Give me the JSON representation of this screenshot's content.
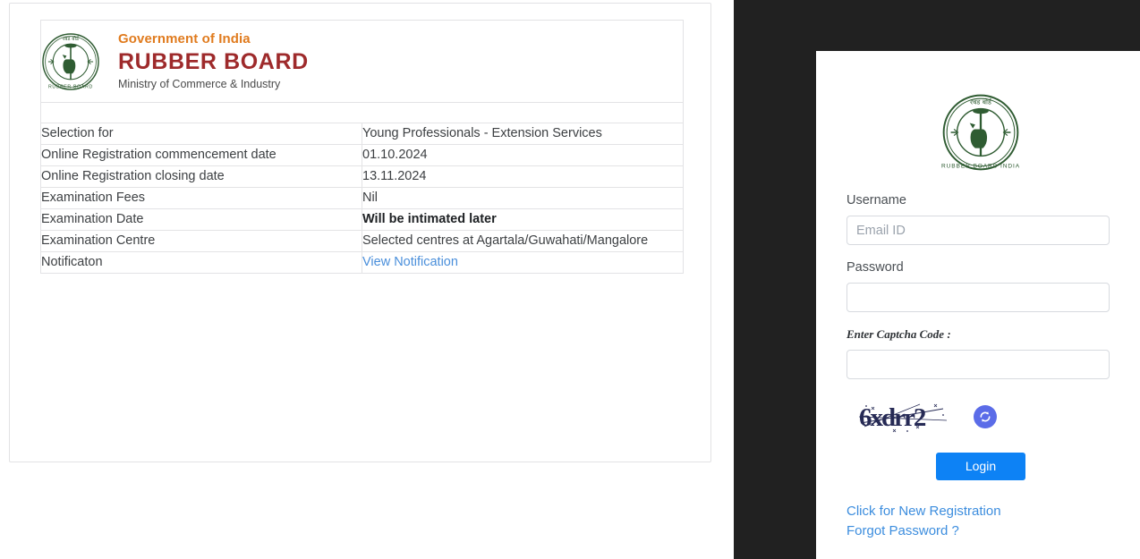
{
  "branding": {
    "emblem_icon": "rubber-board-emblem-icon",
    "gov_line": "Government of India",
    "org_name": "RUBBER BOARD",
    "ministry_line": "Ministry of Commerce & Industry",
    "colors": {
      "gov_orange": "#e07b1e",
      "org_maroon": "#9e2a2b",
      "emblem_green": "#2f5c32"
    }
  },
  "info_table": {
    "rows": [
      {
        "label": "Selection for",
        "value": "Young Professionals - Extension Services",
        "bold": false,
        "link": false
      },
      {
        "label": "Online Registration commencement date",
        "value": "01.10.2024",
        "bold": false,
        "link": false
      },
      {
        "label": "Online Registration closing date",
        "value": "13.11.2024",
        "bold": false,
        "link": false
      },
      {
        "label": "Examination Fees",
        "value": "Nil",
        "bold": false,
        "link": false
      },
      {
        "label": "Examination Date",
        "value": "Will be intimated later",
        "bold": true,
        "link": false
      },
      {
        "label": "Examination Centre",
        "value": "Selected centres at Agartala/Guwahati/Mangalore",
        "bold": false,
        "link": false
      },
      {
        "label": "Notificaton",
        "value": "View Notification",
        "bold": false,
        "link": true
      }
    ]
  },
  "login": {
    "emblem_icon": "rubber-board-emblem-icon",
    "username_label": "Username",
    "username_placeholder": "Email ID",
    "username_value": "",
    "password_label": "Password",
    "password_placeholder": "",
    "password_value": "",
    "captcha_label": "Enter Captcha Code :",
    "captcha_input_placeholder": "",
    "captcha_input_value": "",
    "captcha_text": "6xdrr2",
    "refresh_icon": "refresh-captcha-icon",
    "login_button": "Login",
    "new_registration_link": "Click for New Registration",
    "forgot_password_link": "Forgot Password ?",
    "colors": {
      "login_button_blue": "#0d82f5",
      "link_blue": "#3c8dde",
      "refresh_purple": "#5b6ce8",
      "captcha_navy": "#262a55",
      "panel_dark": "#212121"
    }
  }
}
